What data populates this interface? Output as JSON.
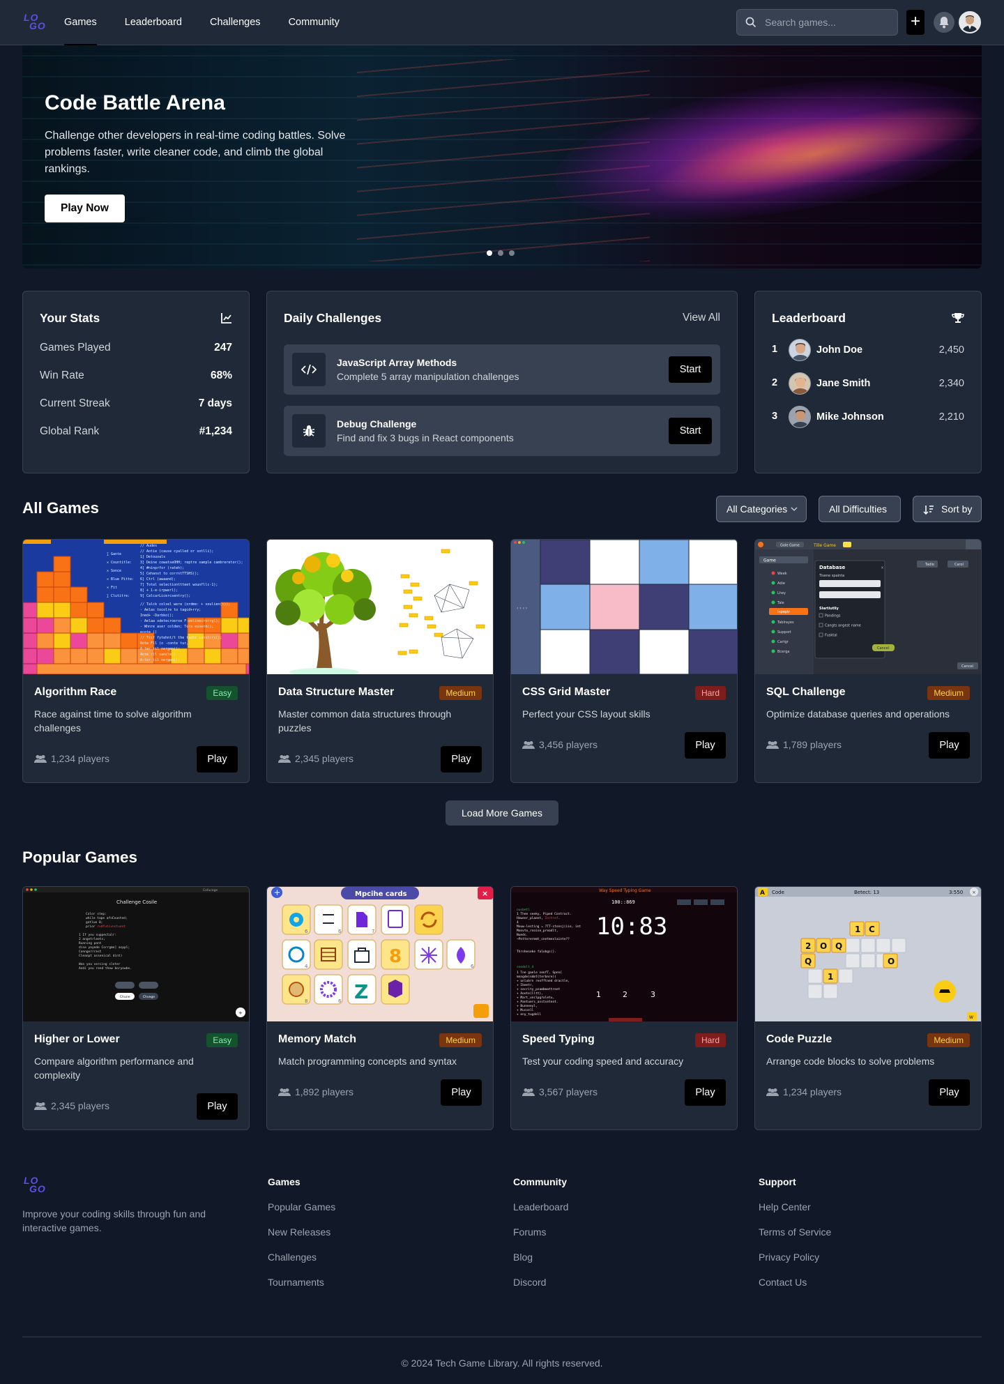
{
  "header": {
    "logo_text": "LOGO",
    "nav": [
      {
        "label": "Games",
        "active": true
      },
      {
        "label": "Leaderboard",
        "active": false
      },
      {
        "label": "Challenges",
        "active": false
      },
      {
        "label": "Community",
        "active": false
      }
    ],
    "search_placeholder": "Search games...",
    "add_label": "+",
    "icons": [
      "search-icon",
      "plus-icon",
      "bell-icon",
      "avatar"
    ]
  },
  "hero": {
    "title": "Code Battle Arena",
    "description": "Challenge other developers in real-time coding battles. Solve problems faster, write cleaner code, and climb the global rankings.",
    "button": "Play Now",
    "slides": 3,
    "active_slide": 1
  },
  "stats": {
    "title": "Your Stats",
    "icon": "chart-line-icon",
    "rows": [
      {
        "label": "Games Played",
        "value": "247"
      },
      {
        "label": "Win Rate",
        "value": "68%"
      },
      {
        "label": "Current Streak",
        "value": "7 days"
      },
      {
        "label": "Global Rank",
        "value": "#1,234"
      }
    ]
  },
  "daily": {
    "title": "Daily Challenges",
    "view_all": "View All",
    "items": [
      {
        "title": "JavaScript Array Methods",
        "desc": "Complete 5 array manipulation challenges",
        "button": "Start",
        "icon": "code-icon"
      },
      {
        "title": "Debug Challenge",
        "desc": "Find and fix 3 bugs in React components",
        "button": "Start",
        "icon": "bug-icon"
      }
    ]
  },
  "leaderboard": {
    "title": "Leaderboard",
    "icon": "trophy-icon",
    "rows": [
      {
        "rank": "1",
        "name": "John Doe",
        "score": "2,450"
      },
      {
        "rank": "2",
        "name": "Jane Smith",
        "score": "2,340"
      },
      {
        "rank": "3",
        "name": "Mike Johnson",
        "score": "2,210"
      }
    ]
  },
  "all_games": {
    "title": "All Games",
    "filters": {
      "category": "All Categories",
      "difficulty": "All Difficulties",
      "sort": "Sort by"
    },
    "cards": [
      {
        "title": "Algorithm Race",
        "difficulty": "Easy",
        "desc": "Race against time to solve algorithm challenges",
        "players": "1,234 players",
        "button": "Play"
      },
      {
        "title": "Data Structure Master",
        "difficulty": "Medium",
        "desc": "Master common data structures through puzzles",
        "players": "2,345 players",
        "button": "Play"
      },
      {
        "title": "CSS Grid Master",
        "difficulty": "Hard",
        "desc": "Perfect your CSS layout skills",
        "players": "3,456 players",
        "button": "Play"
      },
      {
        "title": "SQL Challenge",
        "difficulty": "Medium",
        "desc": "Optimize database queries and operations",
        "players": "1,789 players",
        "button": "Play"
      }
    ],
    "load_more": "Load More Games"
  },
  "popular_games": {
    "title": "Popular Games",
    "cards": [
      {
        "title": "Higher or Lower",
        "difficulty": "Easy",
        "desc": "Compare algorithm performance and complexity",
        "players": "2,345 players",
        "button": "Play"
      },
      {
        "title": "Memory Match",
        "difficulty": "Medium",
        "desc": "Match programming concepts and syntax",
        "players": "1,892 players",
        "button": "Play"
      },
      {
        "title": "Speed Typing",
        "difficulty": "Hard",
        "desc": "Test your coding speed and accuracy",
        "players": "3,567 players",
        "button": "Play"
      },
      {
        "title": "Code Puzzle",
        "difficulty": "Medium",
        "desc": "Arrange code blocks to solve problems",
        "players": "1,234 players",
        "button": "Play"
      }
    ]
  },
  "thumbs": {
    "challenge_console": "Challenge Cosile",
    "memory_header": "Mpcihe cards",
    "typing_header": "Way Speed Typing Game",
    "typing_clock": "10:83",
    "typing_small": "100::869",
    "typing_nums": [
      "1",
      "2",
      "3"
    ],
    "puzzle_header": "Code",
    "puzzle_mid": "Betect: 13",
    "puzzle_right": "3:550",
    "sql_title": "Database",
    "sql_tab": "Tille Game",
    "sql_cancel": "Cancel"
  },
  "footer": {
    "logo_text": "LOGO",
    "description": "Improve your coding skills through fun and interactive games.",
    "columns": [
      {
        "heading": "Games",
        "links": [
          "Popular Games",
          "New Releases",
          "Challenges",
          "Tournaments"
        ]
      },
      {
        "heading": "Community",
        "links": [
          "Leaderboard",
          "Forums",
          "Blog",
          "Discord"
        ]
      },
      {
        "heading": "Support",
        "links": [
          "Help Center",
          "Terms of Service",
          "Privacy Policy",
          "Contact Us"
        ]
      }
    ],
    "copyright": "© 2024 Tech Game Library. All rights reserved."
  },
  "colors": {
    "background": "#111827",
    "surface": "#1f2937",
    "border": "#374151",
    "logo": "#5b4fe6",
    "easy": "#86efac",
    "medium": "#fcd34d",
    "hard": "#fca5a5"
  }
}
